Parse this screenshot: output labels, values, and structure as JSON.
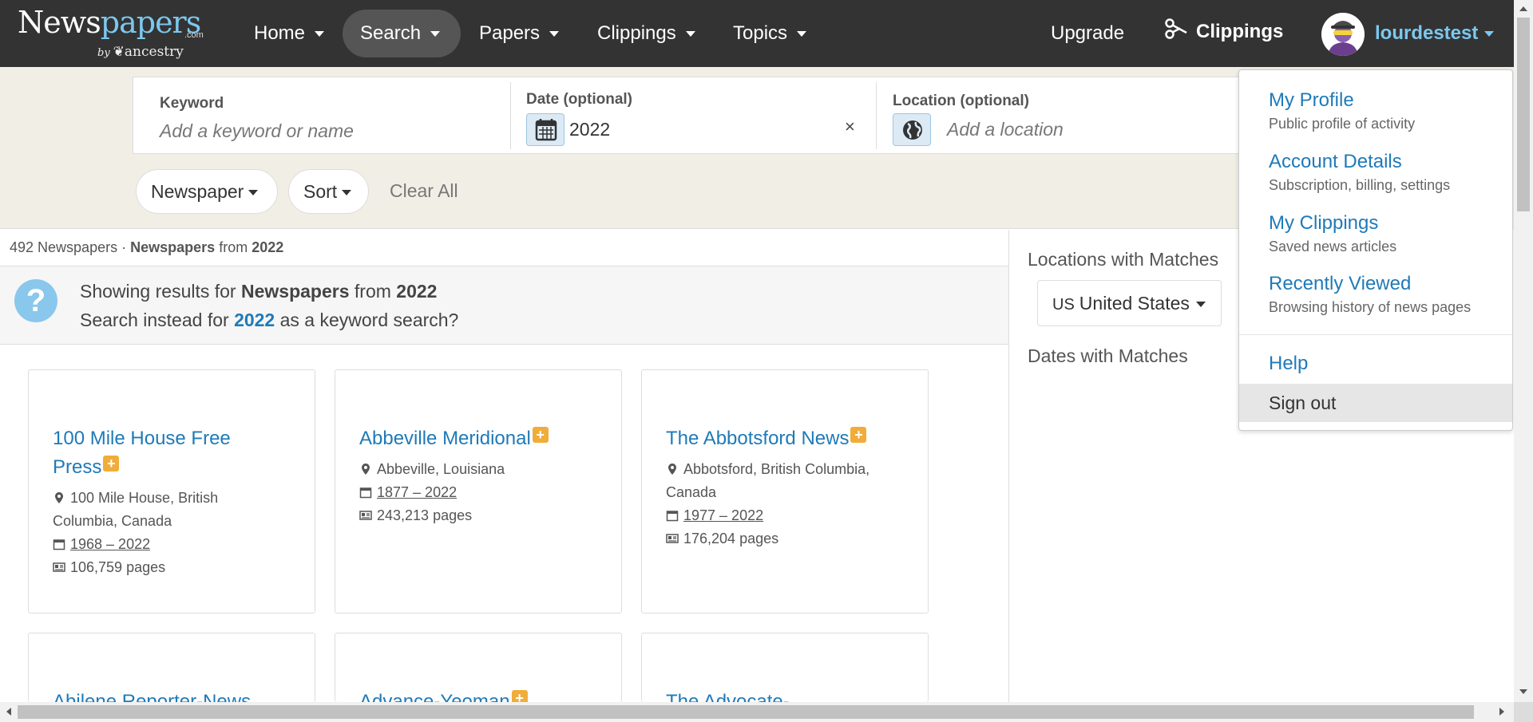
{
  "brand": {
    "name_a": "News",
    "name_b": "papers",
    "com": ".com",
    "by": "by",
    "ancestry": "ancestry"
  },
  "nav": {
    "home": "Home",
    "search": "Search",
    "papers": "Papers",
    "clippings": "Clippings",
    "topics": "Topics",
    "upgrade": "Upgrade",
    "clippings_button": "Clippings",
    "username": "lourdestest"
  },
  "search": {
    "keyword_label": "Keyword",
    "keyword_placeholder": "Add a keyword or name",
    "date_label": "Date (optional)",
    "date_value": "2022",
    "clear_symbol": "×",
    "location_label": "Location (optional)",
    "location_placeholder": "Add a location"
  },
  "filters": {
    "newspaper": "Newspaper",
    "sort": "Sort",
    "clear_all": "Clear All"
  },
  "results": {
    "count": "492 Newspapers",
    "sep": "·",
    "crumb_bold": "Newspapers",
    "crumb_from": "from",
    "crumb_year": "2022",
    "info_l1_pre": "Showing results for",
    "info_l1_bold": "Newspapers",
    "info_l1_from": "from",
    "info_l1_year": "2022",
    "info_l2_pre": "Search instead for",
    "info_l2_link": "2022",
    "info_l2_post": "as a keyword search?"
  },
  "cards": [
    {
      "title_l1": "100 Mile House Free",
      "title_l2": "Press",
      "plus": "+",
      "loc_l1": "100 Mile House, British",
      "loc_l2": "Columbia, Canada",
      "dates": "1968 – 2022",
      "pages": "106,759 pages"
    },
    {
      "title_l1": "Abbeville Meridional",
      "plus": "+",
      "loc_l1": "Abbeville, Louisiana",
      "dates": "1877 – 2022",
      "pages": "243,213 pages"
    },
    {
      "title_l1": "The Abbotsford News",
      "plus": "+",
      "loc_l1": "Abbotsford, British Columbia,",
      "loc_l2": "Canada",
      "dates": "1977 – 2022",
      "pages": "176,204 pages"
    },
    {
      "title_l1": "Abilene Reporter-News"
    },
    {
      "title_l1": "Advance-Yeoman",
      "plus": "+"
    },
    {
      "title_l1": "The Advocate-"
    }
  ],
  "sidebar": {
    "locations_heading": "Locations with Matches",
    "country_code": "US",
    "country": "United States",
    "dates_heading": "Dates with Matches"
  },
  "menu": {
    "items": [
      {
        "title": "My Profile",
        "sub": "Public profile of activity"
      },
      {
        "title": "Account Details",
        "sub": "Subscription, billing, settings"
      },
      {
        "title": "My Clippings",
        "sub": "Saved news articles"
      },
      {
        "title": "Recently Viewed",
        "sub": "Browsing history of news pages"
      }
    ],
    "help": "Help",
    "sign_out": "Sign out"
  },
  "colors": {
    "nav_bg": "#333333",
    "link": "#1f7ab8",
    "accent_light": "#7cc8ef",
    "plus_badge": "#f0ad3a",
    "band_bg": "#f1eee6"
  }
}
